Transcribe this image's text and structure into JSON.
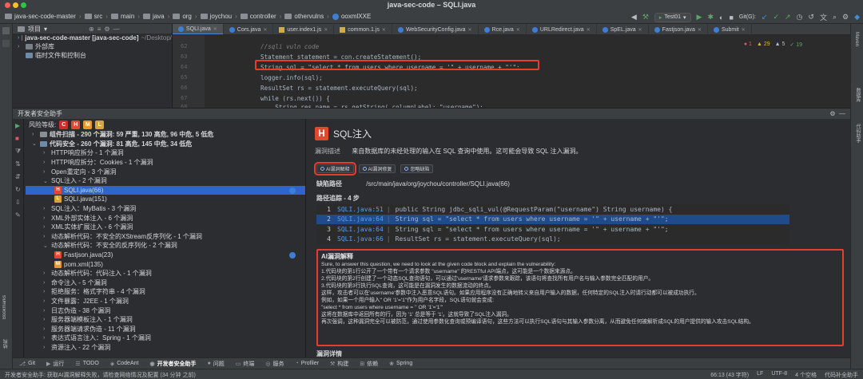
{
  "window": {
    "title": "java-sec-code – SQLI.java"
  },
  "breadcrumb": [
    "java-sec-code-master",
    "src",
    "main",
    "java",
    "org",
    "joychou",
    "controller",
    "othervulns",
    "ooxmlXXE"
  ],
  "toolbar": {
    "run_config": "Test01",
    "git_label": "Git(G):"
  },
  "project": {
    "header": "项目",
    "root": "java-sec-code-master [java-sec-code]",
    "root_path": "~/Desktop/",
    "items": [
      "外部库",
      "临时文件和控制台"
    ]
  },
  "tabs": [
    {
      "label": "SQLI.java",
      "type": "java",
      "active": true
    },
    {
      "label": "Cors.java",
      "type": "java"
    },
    {
      "label": "user.index1.js",
      "type": "js"
    },
    {
      "label": "common.1.js",
      "type": "js"
    },
    {
      "label": "WebSecurityConfig.java",
      "type": "java"
    },
    {
      "label": "Rce.java",
      "type": "java"
    },
    {
      "label": "URLRedirect.java",
      "type": "java"
    },
    {
      "label": "SpEL.java",
      "type": "java"
    },
    {
      "label": "Fastjson.java",
      "type": "java"
    },
    {
      "label": "Submit",
      "type": "java"
    }
  ],
  "editor": {
    "lines": [
      {
        "n": "62",
        "text": "//sqli vuln code"
      },
      {
        "n": "63",
        "text": "Statement statement = con.createStatement();"
      },
      {
        "n": "64",
        "text": "String sql = \"select * from users where username = '\" + username + \"'\";"
      },
      {
        "n": "65",
        "text": "logger.info(sql);"
      },
      {
        "n": "66",
        "text": "ResultSet rs = statement.executeQuery(sql);"
      },
      {
        "n": "67",
        "text": "while (rs.next()) {"
      },
      {
        "n": "68",
        "text": "    String res_name = rs.getString( columnLabel: \"username\");"
      }
    ],
    "inspections": {
      "errors": "1",
      "warnings": "29",
      "weak": "5",
      "typos": "19"
    }
  },
  "toolwindow": {
    "title": "开发者安全助手",
    "risk_label": "风险等级:",
    "risk_levels": [
      "C",
      "H",
      "M",
      "L"
    ],
    "tree": [
      {
        "indent": 0,
        "arrow": "›",
        "text": "组件扫描 - 290 个漏洞: 59 严重, 130 高危, 96 中危, 5 低危",
        "bold": true
      },
      {
        "indent": 0,
        "arrow": "⌄",
        "text": "代码安全 - 260 个漏洞: 81 高危, 145 中危, 34 低危",
        "bold": true
      },
      {
        "indent": 1,
        "arrow": "›",
        "text": "HTTP响应拆分 - 1 个漏洞"
      },
      {
        "indent": 1,
        "arrow": "›",
        "text": "HTTP响应拆分：Cookies - 1 个漏洞"
      },
      {
        "indent": 1,
        "arrow": "›",
        "text": "Open重定向 - 3 个漏洞"
      },
      {
        "indent": 1,
        "arrow": "⌄",
        "text": "SQL注入 - 2 个漏洞"
      },
      {
        "indent": 2,
        "badge": "H",
        "text": "SQLI.java(66)",
        "selected": true,
        "dot": "filled"
      },
      {
        "indent": 2,
        "badge": "L",
        "text": "SQLI.java(151)"
      },
      {
        "indent": 1,
        "arrow": "›",
        "text": "SQL注入：MyBatis - 3 个漏洞"
      },
      {
        "indent": 1,
        "arrow": "›",
        "text": "XML外部实体注入 - 6 个漏洞"
      },
      {
        "indent": 1,
        "arrow": "›",
        "text": "XML实体扩展注入 - 6 个漏洞"
      },
      {
        "indent": 1,
        "arrow": "›",
        "text": "动态解析代码：不安全的XStream反序列化 - 1 个漏洞"
      },
      {
        "indent": 1,
        "arrow": "⌄",
        "text": "动态解析代码：不安全的反序列化 - 2 个漏洞"
      },
      {
        "indent": 2,
        "badge": "H",
        "text": "Fastjson.java(23)",
        "dot": "filled"
      },
      {
        "indent": 2,
        "badge": "M",
        "text": "pom.xml(135)"
      },
      {
        "indent": 1,
        "arrow": "›",
        "text": "动态解析代码：代码注入 - 1 个漏洞"
      },
      {
        "indent": 1,
        "arrow": "›",
        "text": "命令注入 - 5 个漏洞"
      },
      {
        "indent": 1,
        "arrow": "›",
        "text": "拒绝服务：格式字符串 - 4 个漏洞"
      },
      {
        "indent": 1,
        "arrow": "›",
        "text": "文件暴露：J2EE - 1 个漏洞"
      },
      {
        "indent": 1,
        "arrow": "›",
        "text": "日志伪造 - 38 个漏洞"
      },
      {
        "indent": 1,
        "arrow": "›",
        "text": "服务器端模板注入 - 1 个漏洞"
      },
      {
        "indent": 1,
        "arrow": "›",
        "text": "服务器端请求伪造 - 11 个漏洞"
      },
      {
        "indent": 1,
        "arrow": "›",
        "text": "表达式语言注入：Spring - 1 个漏洞"
      },
      {
        "indent": 1,
        "arrow": "›",
        "text": "资源注入 - 22 个漏洞"
      }
    ],
    "detail": {
      "title": "SQL注入",
      "desc_label": "漏洞描述",
      "desc": "来自数据库的未经处理的输入在 SQL 查询中使用。这可能会导致 SQL 注入漏洞。",
      "buttons": [
        "AI漏洞解释",
        "AI漏洞修复",
        "忽略缺陷"
      ],
      "path_label": "缺陷路径",
      "path": "/src/main/java/org/joychou/controller/SQLI.java(66)",
      "trace_label": "路径追踪 - 4 步",
      "trace": [
        {
          "n": "1",
          "file": "SQLI.java:51",
          "code": "public String jdbc_sqli_vul(@RequestParam(\"username\") String username) {"
        },
        {
          "n": "2",
          "file": "SQLI.java:64",
          "code": "String sql = \"select * from users where username = '\" + username + \"'\";",
          "selected": true
        },
        {
          "n": "3",
          "file": "SQLI.java:64",
          "code": "String sql = \"select * from users where username = '\" + username + \"'\";"
        },
        {
          "n": "4",
          "file": "SQLI.java:66",
          "code": "ResultSet rs = statement.executeQuery(sql);"
        }
      ],
      "ai_title": "AI漏洞解释",
      "ai_lines": [
        "Sure, to answer this question, we need to look at the given code block and explain the vulnerability:",
        "1.代码块的第1行公开了一个带有一个请求参数 \"username\" 的RESTful API端点，这可能是一个数据来源点。",
        "2.代码块的第2行创建了一个动态SQL查询语句，可以通过'username'请求参数来跟踪，该语句将查找所有用户名与输入参数完全匹配的用户。",
        "3.代码块的第3行执行SQL查询，这可能是在漏洞发生的数据流动的终点。",
        "这样，攻击者可以在'username'参数中注入恶意SQL语句。如果应用程序没有正确地转义来自用户输入的数据，任何特定的SQL注入时请行动都可以被成功执行。",
        "例如，如果一个用户输入\" OR '1'='1\"作为用户名字段，SQL语句就会变成:",
        "\"select * from users where username = '' OR '1'='1'\"",
        "这将在数据库中返回所有的行，因为 '1' 总是等于 '1'。这就导致了SQL注入漏洞。",
        "再次强调，这种漏洞完全可以被防范，通过使用参数化查询或预编译语句，这些方法可以执行SQL语句与其输入参数分离，从而避免任何被解析成SQL的用户提供的输入攻击SQL结构。"
      ],
      "detail_label": "漏洞详情"
    }
  },
  "bottom_tabs": [
    "Git",
    "运行",
    "TODO",
    "CodeAnt",
    "开发者安全助手",
    "问题",
    "终端",
    "服务",
    "Profiler",
    "构建",
    "依赖",
    "Spring"
  ],
  "status": {
    "left": "开发者安全助手: 获取AI漏洞解释失败，请检查网络情况及配置 (34 分钟 之前)",
    "right": [
      "66:13 (43 字符)",
      "LF",
      "UTF-8",
      "4 个空格",
      "代码补全助手"
    ]
  },
  "gutter": {
    "left_tabs": [
      "Bookmarks",
      "结构"
    ],
    "right_tabs": [
      "Maven",
      "数据库",
      "代码助手"
    ]
  },
  "colors": {
    "accent": "#4a88c7",
    "highlight_red": "#e53f2b",
    "high": "#e0492f",
    "medium": "#e69a2e",
    "low": "#d4a63b",
    "critical": "#e0492f"
  }
}
